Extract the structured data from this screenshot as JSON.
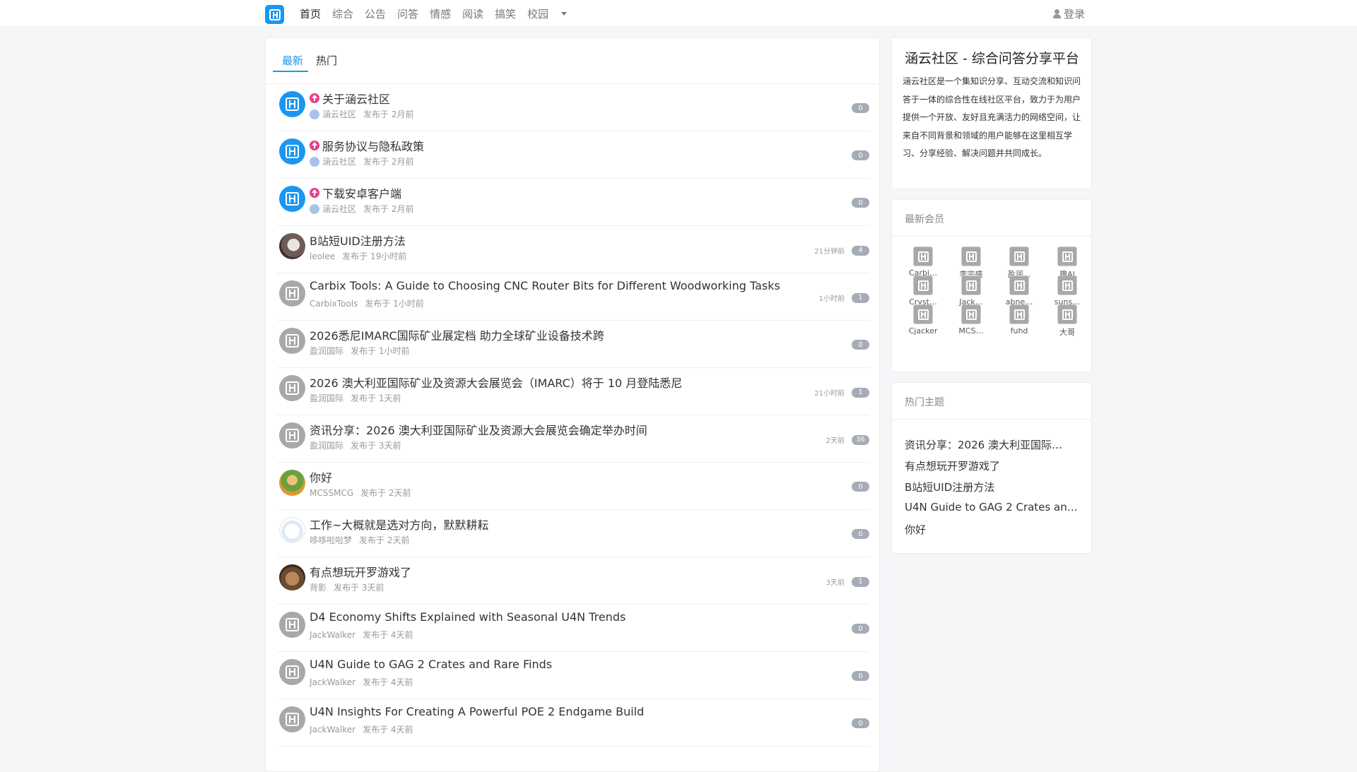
{
  "nav": {
    "items": [
      "首页",
      "综合",
      "公告",
      "问答",
      "情感",
      "阅读",
      "搞笑",
      "校园"
    ],
    "login": "登录"
  },
  "tabs": [
    "最新",
    "热门"
  ],
  "topics": [
    {
      "title": "关于涵云社区",
      "pinned": true,
      "avatar": "brand",
      "author": "涵云社区",
      "posted": "发布于 2月前",
      "last": "",
      "count": "0"
    },
    {
      "title": "服务协议与隐私政策",
      "pinned": true,
      "avatar": "brand",
      "author": "涵云社区",
      "posted": "发布于 2月前",
      "last": "",
      "count": "0"
    },
    {
      "title": "下载安卓客户端",
      "pinned": true,
      "avatar": "brand",
      "author": "涵云社区",
      "posted": "发布于 2月前",
      "last": "",
      "count": "0"
    },
    {
      "title": "B站短UID注册方法",
      "pinned": false,
      "avatar": "photo1",
      "author": "leolee",
      "posted": "发布于 19小时前",
      "last": "21分钟前",
      "count": "4"
    },
    {
      "title": "Carbix Tools: A Guide to Choosing CNC Router Bits for Different Woodworking Tasks",
      "pinned": false,
      "avatar": "grey",
      "author": "CarbixTools",
      "posted": "发布于 1小时前",
      "last": "1小时前",
      "count": "1"
    },
    {
      "title": "2026悉尼IMARC国际矿业展定档 助力全球矿业设备技术跨",
      "pinned": false,
      "avatar": "grey",
      "author": "盈润国际",
      "posted": "发布于 1小时前",
      "last": "",
      "count": "0"
    },
    {
      "title": "2026 澳大利亚国际矿业及资源大会展览会（IMARC）将于 10 月登陆悉尼",
      "pinned": false,
      "avatar": "grey",
      "author": "盈润国际",
      "posted": "发布于 1天前",
      "last": "21小时前",
      "count": "1"
    },
    {
      "title": "资讯分享：2026 澳大利亚国际矿业及资源大会展览会确定举办时间",
      "pinned": false,
      "avatar": "grey",
      "author": "盈润国际",
      "posted": "发布于 3天前",
      "last": "2天前",
      "count": "36"
    },
    {
      "title": "你好",
      "pinned": false,
      "avatar": "photo2",
      "author": "MCSSMCG",
      "posted": "发布于 2天前",
      "last": "",
      "count": "0"
    },
    {
      "title": "工作~大概就是选对方向，默默耕耘",
      "pinned": false,
      "avatar": "photo3",
      "author": "哆哆啦啦梦",
      "posted": "发布于 2天前",
      "last": "",
      "count": "0"
    },
    {
      "title": "有点想玩开罗游戏了",
      "pinned": false,
      "avatar": "photo4",
      "author": "背影",
      "posted": "发布于 3天前",
      "last": "3天前",
      "count": "1"
    },
    {
      "title": "D4 Economy Shifts Explained with Seasonal U4N Trends",
      "pinned": false,
      "avatar": "grey",
      "author": "JackWalker",
      "posted": "发布于 4天前",
      "last": "",
      "count": "0"
    },
    {
      "title": "U4N Guide to GAG 2 Crates and Rare Finds",
      "pinned": false,
      "avatar": "grey",
      "author": "JackWalker",
      "posted": "发布于 4天前",
      "last": "",
      "count": "0"
    },
    {
      "title": "U4N Insights For Creating A Powerful POE 2 Endgame Build",
      "pinned": false,
      "avatar": "grey",
      "author": "JackWalker",
      "posted": "发布于 4天前",
      "last": "",
      "count": "0"
    }
  ],
  "about": {
    "title": "涵云社区 - 综合问答分享平台",
    "text": "涵云社区是一个集知识分享、互动交流和知识问答于一体的综合性在线社区平台，致力于为用户提供一个开放、友好且充满活力的网络空间，让来自不同背景和领域的用户能够在这里相互学习、分享经验、解决问题并共同成长。"
  },
  "members": {
    "title": "最新会员",
    "names": [
      "Carbi…",
      "李宗盛",
      "盈润…",
      "趣AI",
      "Cryst…",
      "Jack…",
      "abne…",
      "suns…",
      "Cjacker",
      "MCS…",
      "fuhd",
      "大哥"
    ]
  },
  "hot": {
    "title": "热门主题",
    "items": [
      "资讯分享：2026 澳大利亚国际…",
      "有点想玩开罗游戏了",
      "B站短UID注册方法",
      "U4N Guide to GAG 2 Crates an…",
      "你好"
    ]
  },
  "colors": {
    "brand": "#1a97f0",
    "pin": "#e83e8c",
    "badge": "#a5acb5"
  }
}
